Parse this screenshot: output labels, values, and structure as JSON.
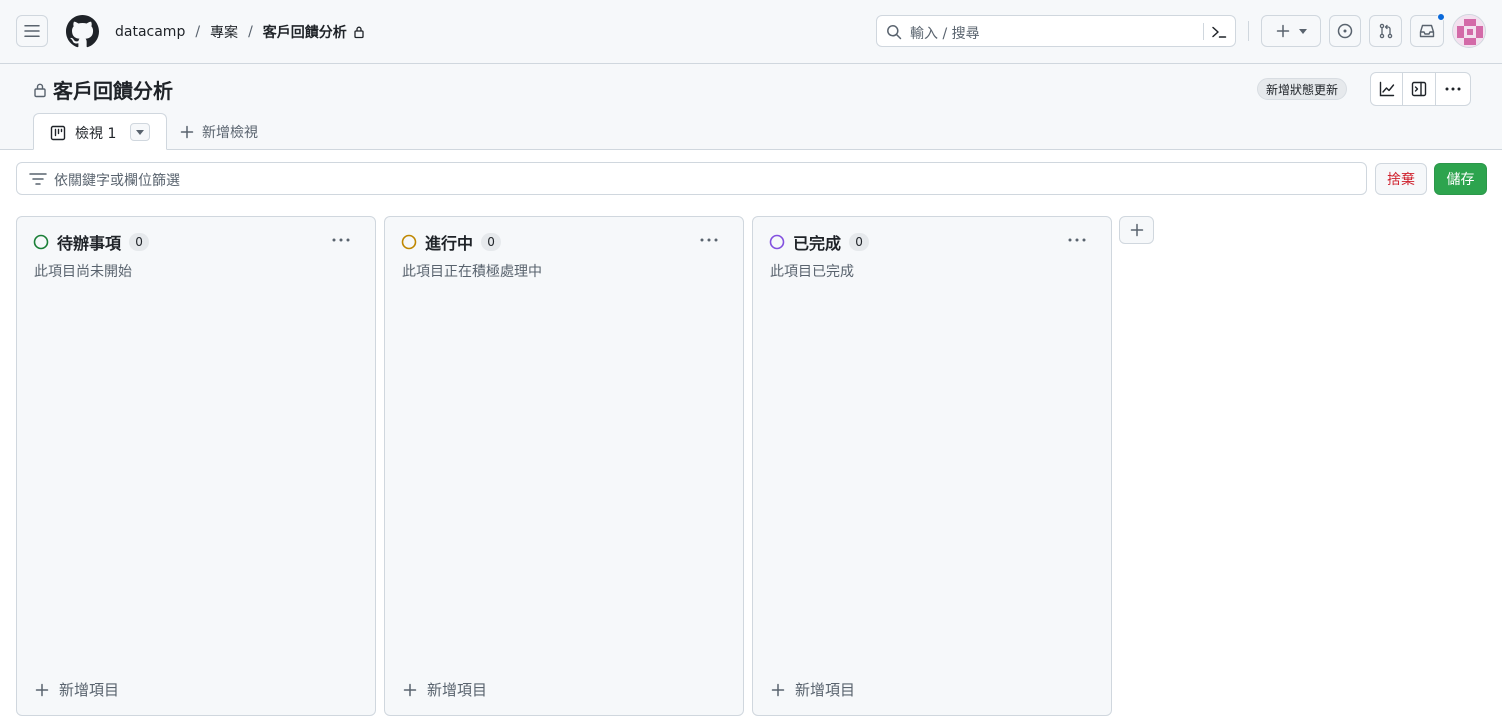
{
  "header": {
    "breadcrumb": {
      "owner": "datacamp",
      "sep1": "/",
      "section": "專案",
      "sep2": "/",
      "project": "客戶回饋分析"
    },
    "search": {
      "placeholder": "輸入 / 搜尋"
    },
    "notification_dot_color": "#0969da",
    "icons": [
      "hamburger-icon",
      "github-logo",
      "lock-icon",
      "search-icon",
      "command-palette-icon",
      "plus-icon",
      "triangle-down-icon",
      "issue-opened-icon",
      "git-pull-request-icon",
      "inbox-icon"
    ]
  },
  "project": {
    "title": "客戶回饋分析",
    "status_update_label": "新增狀態更新",
    "tabs": [
      {
        "label": "檢視 1"
      }
    ],
    "new_view_label": "新增檢視"
  },
  "filter": {
    "placeholder": "依關鍵字或欄位篩選",
    "discard_label": "捨棄",
    "save_label": "儲存"
  },
  "columns": [
    {
      "name": "待辦事項",
      "count": "0",
      "description": "此項目尚未開始",
      "status_color": "#1a7f37",
      "add_item_label": "新增項目"
    },
    {
      "name": "進行中",
      "count": "0",
      "description": "此項目正在積極處理中",
      "status_color": "#bf8700",
      "add_item_label": "新增項目"
    },
    {
      "name": "已完成",
      "count": "0",
      "description": "此項目已完成",
      "status_color": "#8250df",
      "add_item_label": "新增項目"
    }
  ],
  "colors": {
    "save_button": "#2da44e",
    "discard_text": "#cf222e",
    "border": "#d0d7de",
    "surface": "#f6f8fa"
  }
}
